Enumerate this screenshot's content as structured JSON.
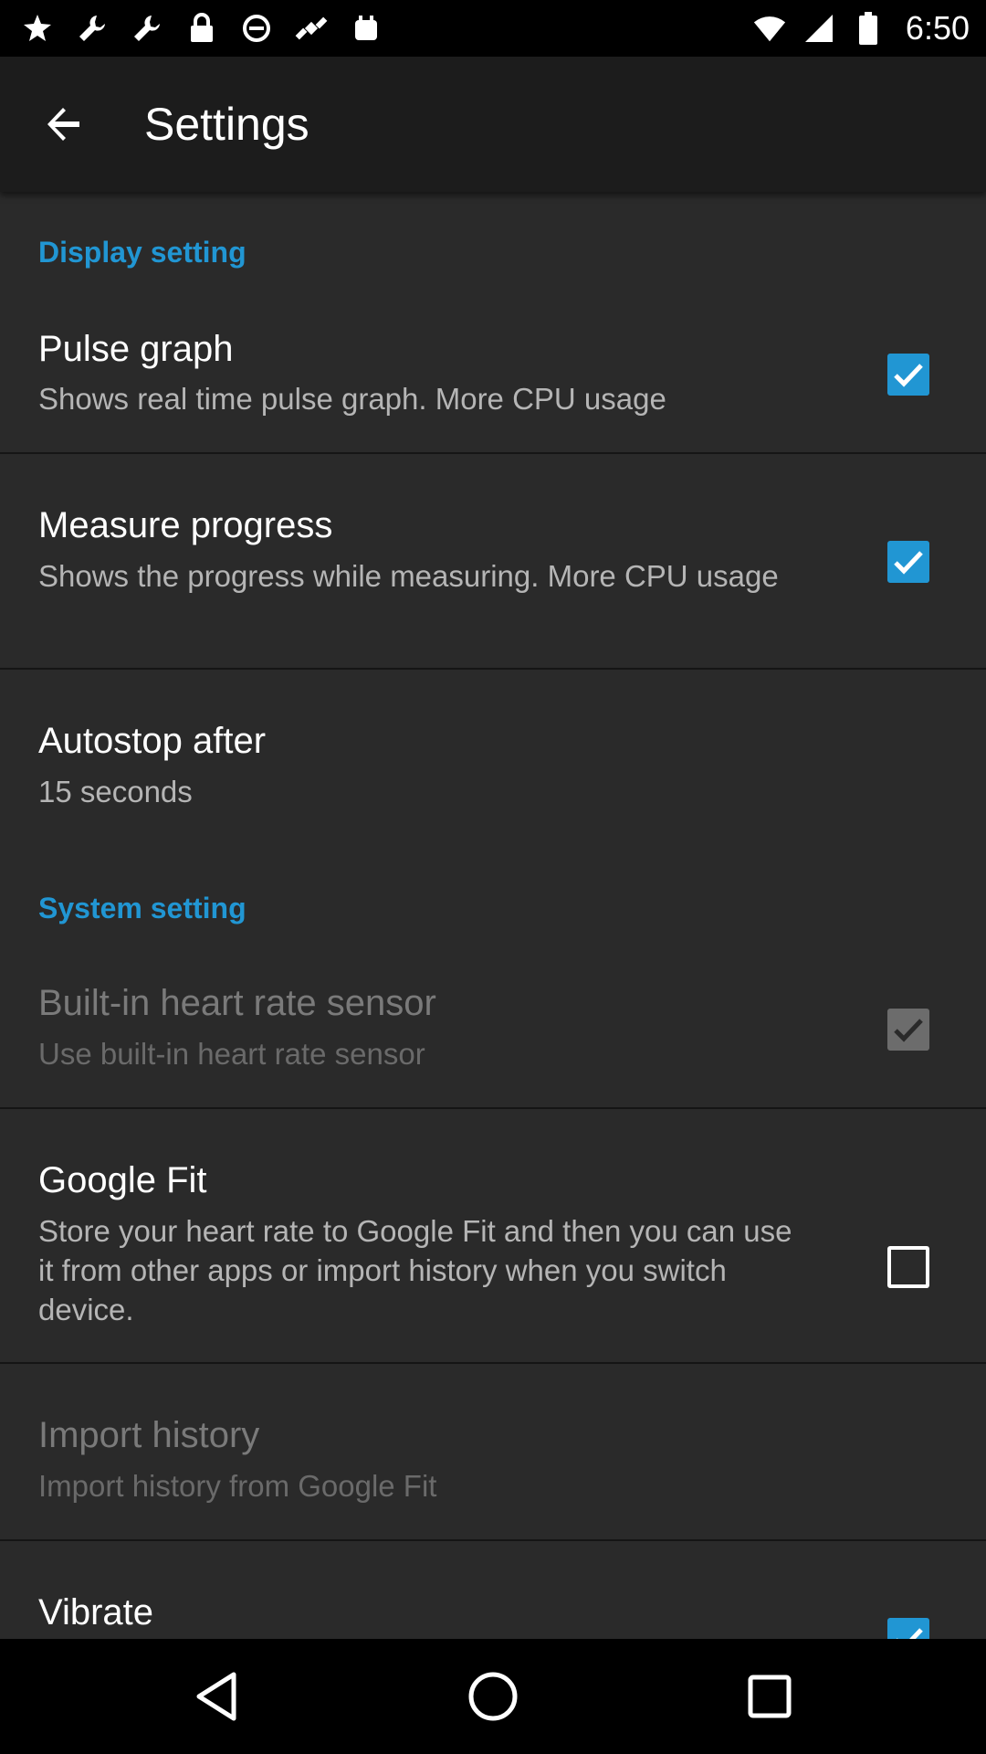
{
  "status_bar": {
    "time": "6:50",
    "left_icons": [
      "app-notification-icon",
      "wrench-icon",
      "wrench-icon",
      "lock-icon",
      "no-sim-icon",
      "fake-gps-satellite-icon",
      "stack-notification-icon"
    ],
    "right_icons": [
      "wifi-icon",
      "signal-icon",
      "battery-icon"
    ]
  },
  "app_bar": {
    "title": "Settings"
  },
  "sections": {
    "display": {
      "header": "Display setting"
    },
    "system": {
      "header": "System setting"
    }
  },
  "prefs": {
    "pulse_graph": {
      "title": "Pulse graph",
      "summary": "Shows real time pulse graph. More CPU usage",
      "checked": true,
      "enabled": true
    },
    "measure_progress": {
      "title": "Measure progress",
      "summary": "Shows the progress while measuring. More CPU usage",
      "checked": true,
      "enabled": true
    },
    "autostop": {
      "title": "Autostop after",
      "summary": "15 seconds"
    },
    "builtin_sensor": {
      "title": "Built-in heart rate sensor",
      "summary": "Use built-in heart rate sensor",
      "checked": true,
      "enabled": false
    },
    "google_fit": {
      "title": "Google Fit",
      "summary": "Store your heart rate to Google Fit and then you can use it from other apps or import history when you switch device.",
      "checked": false,
      "enabled": true
    },
    "import_history": {
      "title": "Import history",
      "summary": "Import history from Google Fit",
      "enabled": false
    },
    "vibrate": {
      "title": "Vibrate",
      "checked": true,
      "enabled": true
    }
  },
  "colors": {
    "accent": "#2196d3",
    "background": "#2a2a2a",
    "app_bar": "#1c1c1c"
  },
  "nav_bar": {
    "icons": [
      "back-triangle-icon",
      "home-circle-icon",
      "recents-square-icon"
    ]
  }
}
